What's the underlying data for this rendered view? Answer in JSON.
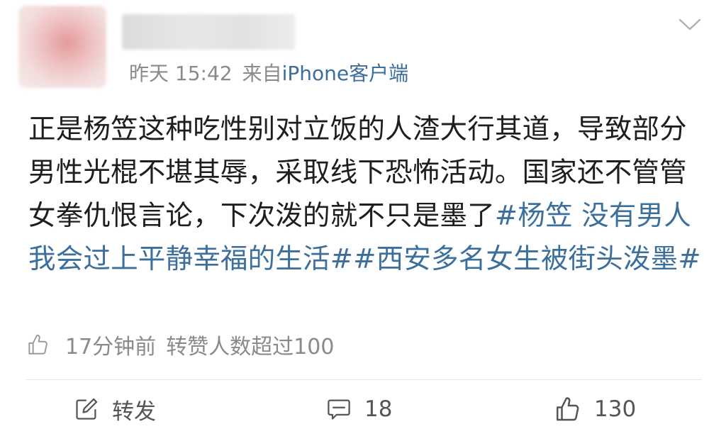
{
  "post": {
    "time": "昨天 15:42",
    "source_prefix": "来自",
    "source": "iPhone客户端",
    "text": "正是杨笠这种吃性别对立饭的人渣大行其道，导致部分男性光棍不堪其辱，采取线下恐怖活动。国家还不管管女拳仇恨言论，下次泼的就不只是墨了",
    "hashtag_1": "#杨笠 没有男人我会过上平静幸福的生活#",
    "hashtag_2": "#西安多名女生被街头泼墨#"
  },
  "stats": {
    "time_ago": "17分钟前",
    "repost_info": "转赞人数超过100"
  },
  "actions": {
    "repost_label": "转发",
    "comment_count": "18",
    "like_count": "130"
  },
  "colors": {
    "link": "#3c6f9c",
    "meta": "#8a8a8a",
    "text": "#1e1e1e"
  },
  "icons": {
    "menu": "chevron-down-icon",
    "stats_like": "thumbs-up-icon",
    "repost": "edit-square-icon",
    "comment": "comment-bubble-icon",
    "like": "thumbs-up-icon"
  }
}
